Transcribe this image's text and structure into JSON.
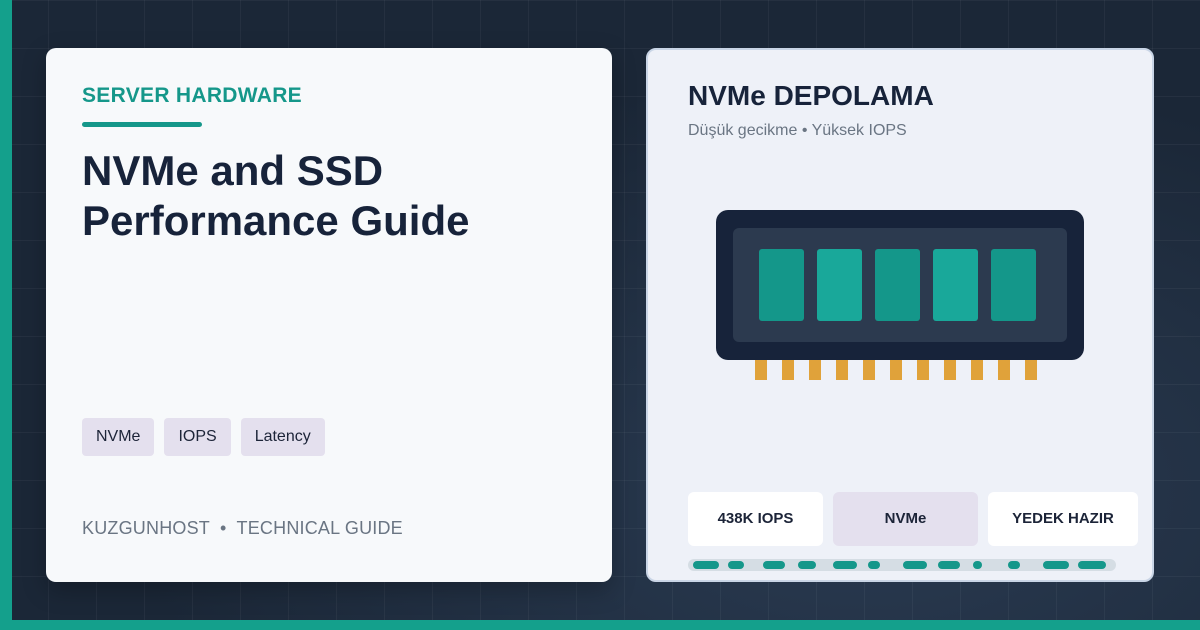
{
  "left": {
    "kicker": "SERVER HARDWARE",
    "title": "NVMe and SSD Performance Guide",
    "tags": [
      "NVMe",
      "IOPS",
      "Latency"
    ],
    "footer_brand": "KUZGUNHOST",
    "footer_separator": "•",
    "footer_label": "TECHNICAL GUIDE"
  },
  "right": {
    "title": "NVMe DEPOLAMA",
    "subtitle": "Düşük gecikme • Yüksek IOPS",
    "chips": [
      "438K IOPS",
      "NVMe",
      "YEDEK HAZIR"
    ]
  },
  "colors": {
    "accent": "#15978a",
    "navy": "#17233a",
    "pins": "#e0a23a",
    "chip_purple": "#e4e0ee"
  },
  "icons": {
    "drive": "nvme-drive-icon"
  }
}
